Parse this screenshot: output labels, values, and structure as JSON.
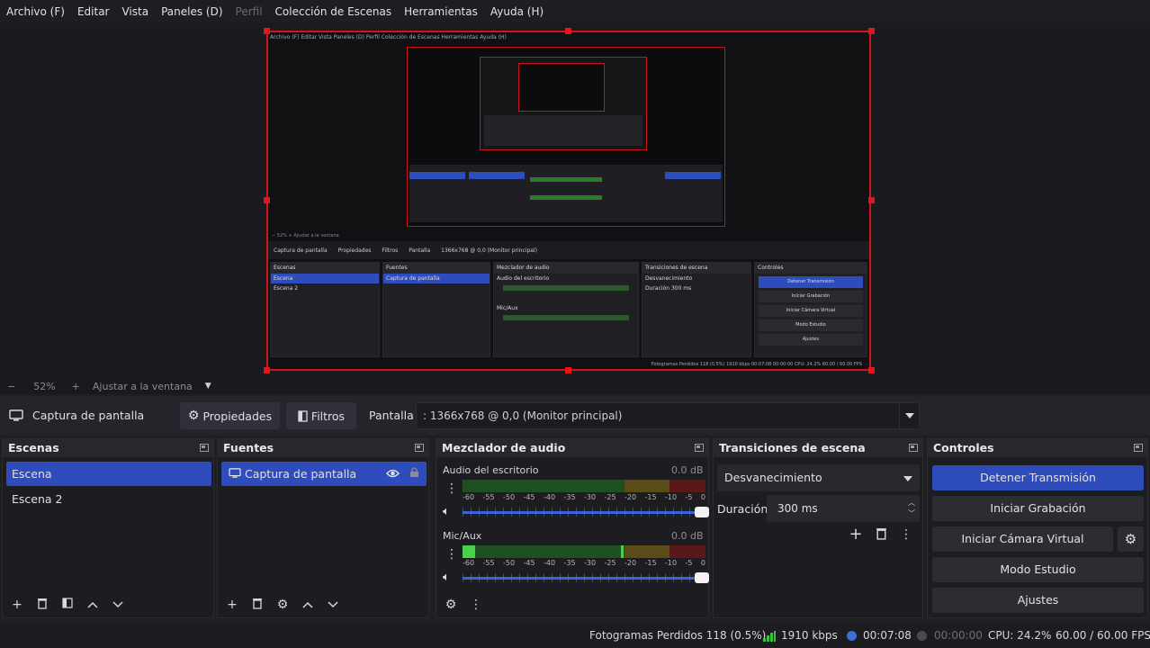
{
  "menu": {
    "archivo": "Archivo (F)",
    "editar": "Editar",
    "vista": "Vista",
    "paneles": "Paneles (D)",
    "perfil": "Perfil",
    "coleccion": "Colección de Escenas",
    "herramientas": "Herramientas",
    "ayuda": "Ayuda (H)"
  },
  "zoom": {
    "minus": "−",
    "value": "52%",
    "plus": "+",
    "fit": "Ajustar a la ventana"
  },
  "source_bar": {
    "source_name": "Captura de pantalla",
    "propiedades": "Propiedades",
    "filtros": "Filtros",
    "pantalla_label": "Pantalla",
    "pantalla_value": ": 1366x768 @ 0,0 (Monitor principal)"
  },
  "scenes": {
    "title": "Escenas",
    "items": [
      "Escena",
      "Escena 2"
    ],
    "selected": 0
  },
  "sources": {
    "title": "Fuentes",
    "items": [
      "Captura de pantalla"
    ]
  },
  "mixer": {
    "title": "Mezclador de audio",
    "channels": [
      {
        "name": "Audio del escritorio",
        "db": "0.0 dB",
        "level": 0.0,
        "peak": null
      },
      {
        "name": "Mic/Aux",
        "db": "0.0 dB",
        "level": 0.05,
        "peak": 0.65
      }
    ],
    "scale": [
      "-60",
      "-55",
      "-50",
      "-45",
      "-40",
      "-35",
      "-30",
      "-25",
      "-20",
      "-15",
      "-10",
      "-5",
      "0"
    ]
  },
  "transitions": {
    "title": "Transiciones de escena",
    "selected": "Desvanecimiento",
    "duration_label": "Duración",
    "duration_value": "300 ms"
  },
  "controls": {
    "title": "Controles",
    "detener": "Detener Transmisión",
    "grabacion": "Iniciar Grabación",
    "camara": "Iniciar Cámara Virtual",
    "estudio": "Modo Estudio",
    "ajustes": "Ajustes"
  },
  "status": {
    "dropped": "Fotogramas Perdidos 118 (0.5%)",
    "bitrate": "1910 kbps",
    "stream_time": "00:07:08",
    "rec_time": "00:00:00",
    "cpu": "CPU: 24.2%",
    "fps": "60.00 / 60.00 FPS"
  },
  "colors": {
    "accent": "#2f4cbc",
    "selection_border": "#d2151d",
    "meter_green": "#48d14a",
    "stream_dot": "#3b6fd8"
  },
  "preview_mini": {
    "menu": "Archivo (F)   Editar   Vista   Paneles (D)   Perfil   Colección de Escenas   Herramientas   Ayuda (H)",
    "zoom": "−  52%  +  Ajustar a la ventana",
    "source": "Captura de pantalla",
    "propiedades": "Propiedades",
    "filtros": "Filtros",
    "pantalla": "Pantalla",
    "pantalla_value": "1366x768 @ 0,0 (Monitor principal)",
    "escenas": "Escenas",
    "escena": "Escena",
    "escena2": "Escena 2",
    "fuentes": "Fuentes",
    "captura": "Captura de pantalla",
    "mezclador": "Mezclador de audio",
    "audio": "Audio del escritorio",
    "mic": "Mic/Aux",
    "transiciones": "Transiciones de escena",
    "desvanecimiento": "Desvanecimiento",
    "duracion": "Duración",
    "dur_value": "300 ms",
    "controles": "Controles",
    "detener": "Detener Transmisión",
    "grabacion": "Iniciar Grabación",
    "camara": "Iniciar Cámara Virtual",
    "estudio": "Modo Estudio",
    "ajustes": "Ajustes",
    "status": "Fotogramas Perdidos 118 (0.5%)   1910 kbps   00:07:08   00:00:00   CPU: 24.2%   60.00 / 60.00 FPS"
  }
}
